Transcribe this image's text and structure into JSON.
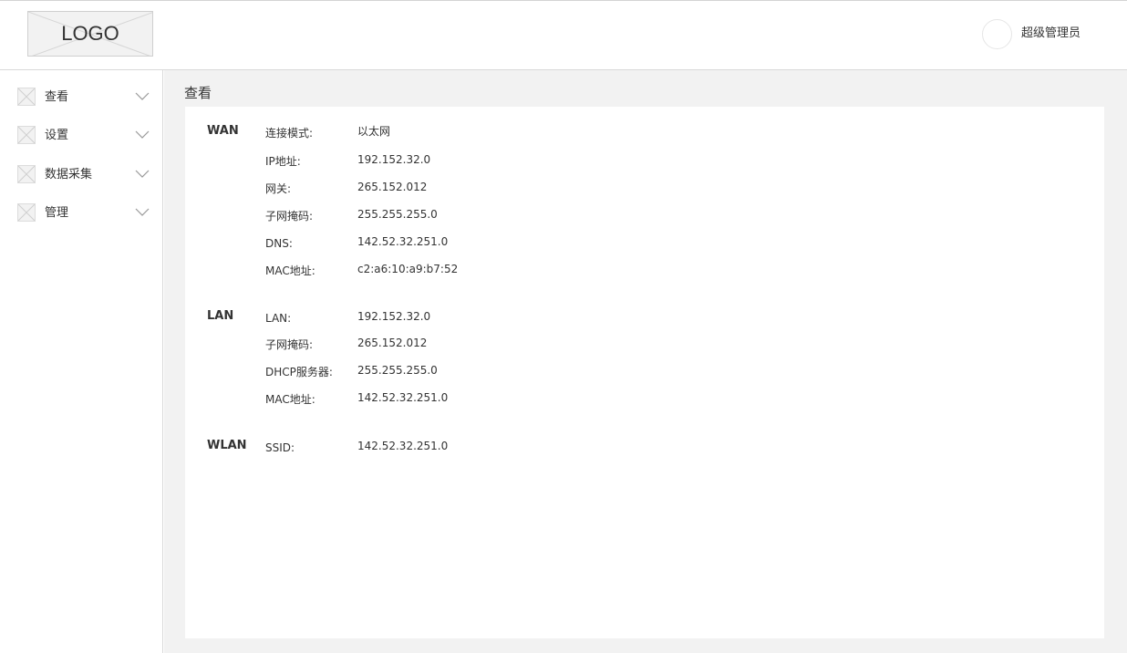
{
  "header": {
    "logo_text": "LOGO",
    "user_name": "超级管理员"
  },
  "sidebar": {
    "items": [
      {
        "label": "查看"
      },
      {
        "label": "设置"
      },
      {
        "label": "数据采集"
      },
      {
        "label": "管理"
      }
    ]
  },
  "main": {
    "title": "查看",
    "sections": [
      {
        "name": "WAN",
        "fields": [
          {
            "label": "连接模式:",
            "value": "以太网"
          },
          {
            "label": "IP地址:",
            "value": "192.152.32.0"
          },
          {
            "label": "网关:",
            "value": "265.152.012"
          },
          {
            "label": "子网掩码:",
            "value": "255.255.255.0"
          },
          {
            "label": "DNS:",
            "value": "142.52.32.251.0"
          },
          {
            "label": "MAC地址:",
            "value": "c2:a6:10:a9:b7:52"
          }
        ]
      },
      {
        "name": "LAN",
        "fields": [
          {
            "label": "LAN:",
            "value": "192.152.32.0"
          },
          {
            "label": "子网掩码:",
            "value": "265.152.012"
          },
          {
            "label": "DHCP服务器:",
            "value": "255.255.255.0"
          },
          {
            "label": "MAC地址:",
            "value": "142.52.32.251.0"
          }
        ]
      },
      {
        "name": "WLAN",
        "fields": [
          {
            "label": "SSID:",
            "value": "142.52.32.251.0"
          }
        ]
      }
    ]
  },
  "colors": {
    "page_background": "#f2f2f2",
    "panel_background": "#ffffff",
    "text": "#333333",
    "border": "#d9d9d9"
  },
  "icons": {
    "logo": "placeholder-image-icon",
    "nav_item": "placeholder-image-icon",
    "nav_expand": "chevron-down-icon",
    "user": "avatar-circle"
  }
}
